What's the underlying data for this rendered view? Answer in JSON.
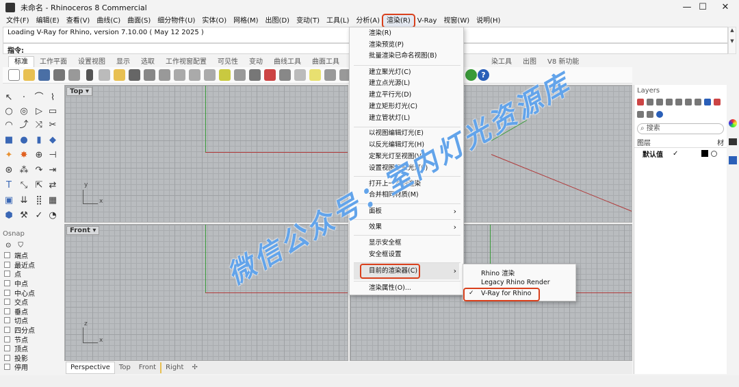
{
  "window": {
    "title": "未命名 - Rhinoceros 8 Commercial",
    "minimize": "—",
    "maximize": "☐",
    "close": "✕"
  },
  "menubar": [
    "文件(F)",
    "编辑(E)",
    "查看(V)",
    "曲线(C)",
    "曲面(S)",
    "细分物件(U)",
    "实体(O)",
    "网格(M)",
    "出图(D)",
    "变动(T)",
    "工具(L)",
    "分析(A)",
    "渲染(R)",
    "V-Ray",
    "视窗(W)",
    "说明(H)"
  ],
  "active_menu": "渲染(R)",
  "command": {
    "history": "Loading V-Ray for Rhino, version 7.10.00 ( May 12 2025 )",
    "prompt": "指令:"
  },
  "tabs": [
    "标准",
    "工作平面",
    "设置视图",
    "显示",
    "选取",
    "工作视窗配置",
    "可见性",
    "变动",
    "曲线工具",
    "曲面工具",
    "实",
    "",
    "",
    "",
    "",
    "染工具",
    "出图",
    "V8 新功能"
  ],
  "viewports": [
    {
      "name": "Top",
      "x_axis": "x",
      "y_axis": "y"
    },
    {
      "name": "Front",
      "x_axis": "x",
      "y_axis": "z"
    }
  ],
  "viewport_tabs": [
    "Perspective",
    "Top",
    "Front",
    "Right",
    "✢"
  ],
  "osnap": {
    "title": "Osnap",
    "items": [
      "端点",
      "最近点",
      "点",
      "中点",
      "中心点",
      "交点",
      "垂点",
      "切点",
      "四分点",
      "节点",
      "顶点",
      "投影",
      "停用"
    ]
  },
  "layers": {
    "title": "Layers",
    "search_placeholder": "搜索",
    "col_name": "图层",
    "col_mat": "材",
    "default_layer": "默认值",
    "check": "✓"
  },
  "render_menu": {
    "items": [
      {
        "label": "渲染(R)"
      },
      {
        "label": "渲染预览(P)"
      },
      {
        "label": "批量渲染已命名视图(B)"
      },
      {
        "label": "建立聚光灯(C)"
      },
      {
        "label": "建立点光源(L)"
      },
      {
        "label": "建立平行光(D)"
      },
      {
        "label": "建立矩形灯光(C)"
      },
      {
        "label": "建立管状灯(L)"
      },
      {
        "label": "以视图编辑灯光(E)"
      },
      {
        "label": "以反光编辑灯光(H)"
      },
      {
        "label": "定聚光灯至视图(V)"
      },
      {
        "label": "设置视图至聚光灯(I)"
      },
      {
        "label": "打开上一次的渲染"
      },
      {
        "label": "合并相同材质(M)"
      },
      {
        "label": "面板",
        "submenu": true
      },
      {
        "label": "效果",
        "submenu": true
      },
      {
        "label": "显示安全框"
      },
      {
        "label": "安全框设置"
      },
      {
        "label": "目前的渲染器(C)",
        "submenu": true
      },
      {
        "label": "渲染属性(O)..."
      }
    ],
    "arrow": "›"
  },
  "renderer_submenu": {
    "items": [
      {
        "label": "Rhino 渲染",
        "checked": false
      },
      {
        "label": "Legacy Rhino Render",
        "checked": false
      },
      {
        "label": "V-Ray for Rhino",
        "checked": true
      }
    ],
    "check": "✓"
  },
  "watermark": "微信公众号：室内灯光资源库",
  "colors": {
    "accent": "#d9401c",
    "x_axis": "#b03a3a",
    "y_axis": "#3a9a3a",
    "watermark": "#4894e6"
  }
}
